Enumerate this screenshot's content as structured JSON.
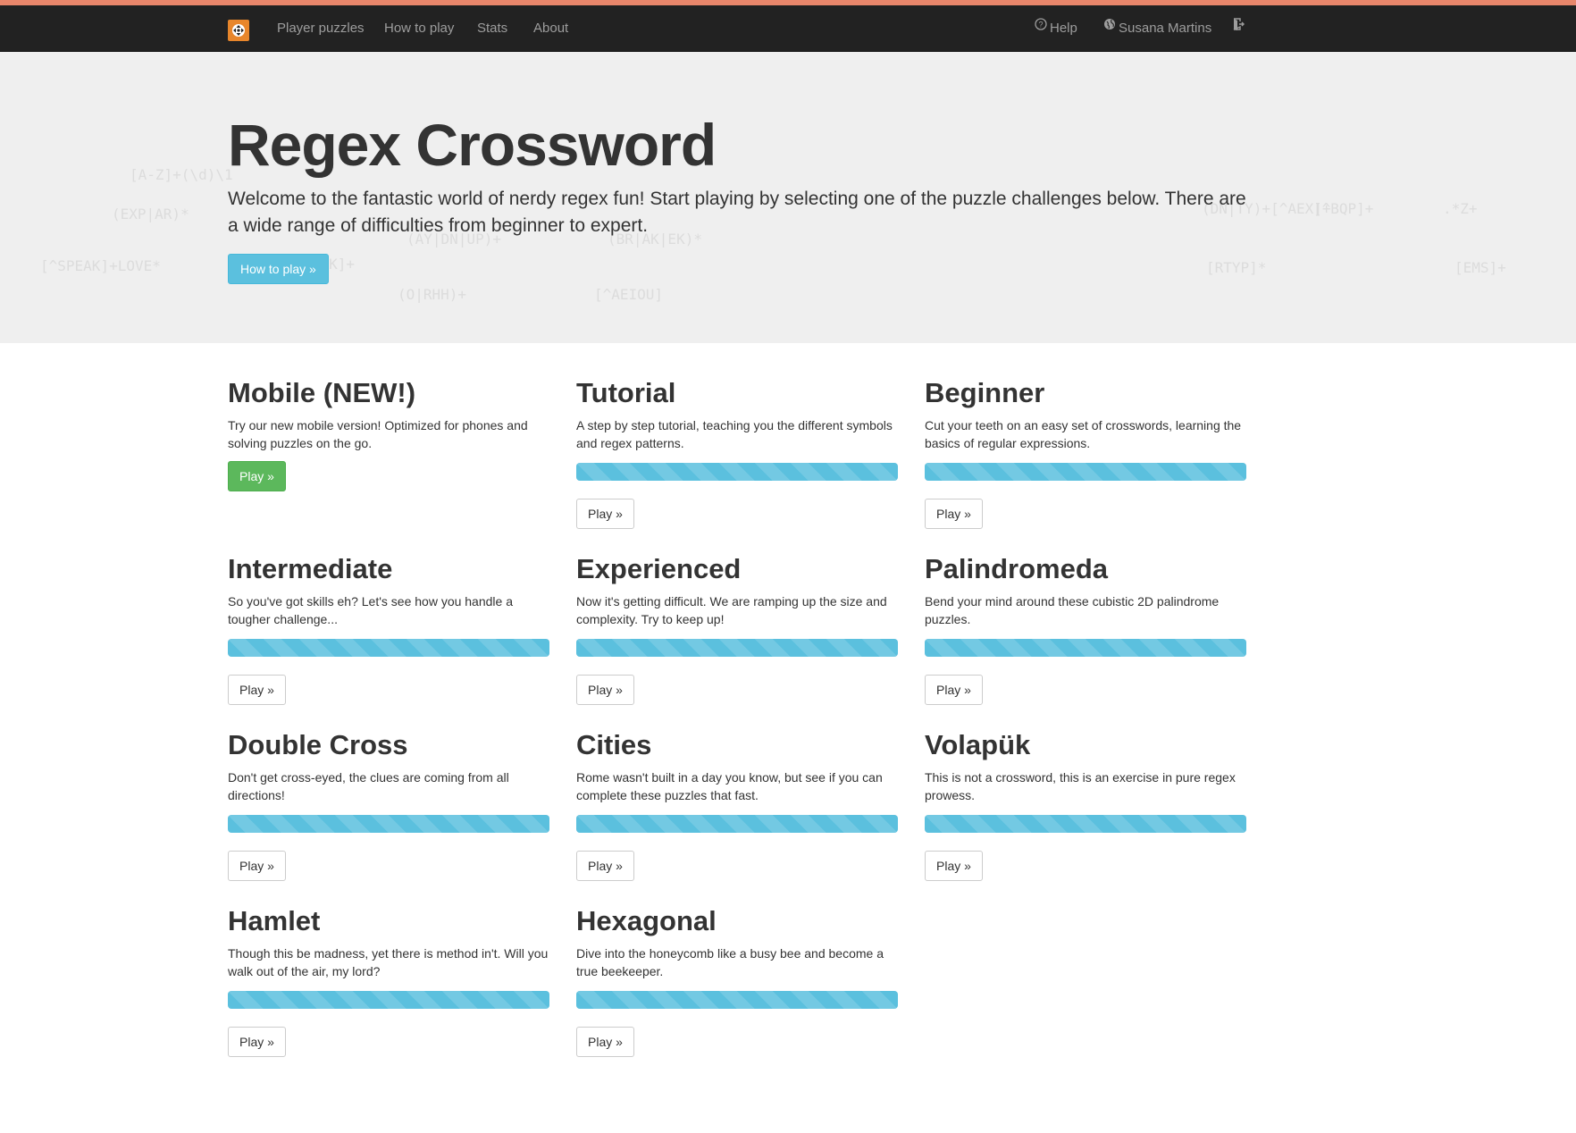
{
  "navbar": {
    "links": [
      "Player puzzles",
      "How to play",
      "Stats",
      "About"
    ],
    "help": "Help",
    "user": "Susana Martins"
  },
  "hero": {
    "title": "Regex Crossword",
    "lead": "Welcome to the fantastic world of nerdy regex fun! Start playing by selecting one of the puzzle challenges below. There are a wide range of difficulties from beginner to expert.",
    "button": "How to play »"
  },
  "puzzles": [
    {
      "title": "Mobile (NEW!)",
      "description": "Try our new mobile version! Optimized for phones and solving puzzles on the go.",
      "button": "Play »"
    },
    {
      "title": "Tutorial",
      "description": "A step by step tutorial, teaching you the different symbols and regex patterns.",
      "progress": 1.0,
      "button": "Play »"
    },
    {
      "title": "Beginner",
      "description": "Cut your teeth on an easy set of crosswords, learning the basics of regular expressions.",
      "progress": 1.0,
      "button": "Play »"
    },
    {
      "title": "Intermediate",
      "description": "So you've got skills eh? Let's see how you handle a tougher challenge...",
      "progress": 1.0,
      "button": "Play »"
    },
    {
      "title": "Experienced",
      "description": "Now it's getting difficult. We are ramping up the size and complexity. Try to keep up!",
      "progress": 1.0,
      "button": "Play »"
    },
    {
      "title": "Palindromeda",
      "description": "Bend your mind around these cubistic 2D palindrome puzzles.",
      "progress": 1.0,
      "button": "Play »"
    },
    {
      "title": "Double Cross",
      "description": "Don't get cross-eyed, the clues are coming from all directions!",
      "progress": 1.0,
      "button": "Play »"
    },
    {
      "title": "Cities",
      "description": "Rome wasn't built in a day you know, but see if you can complete these puzzles that fast.",
      "progress": 1.0,
      "button": "Play »"
    },
    {
      "title": "Volapük",
      "description": "This is not a crossword, this is an exercise in pure regex prowess.",
      "progress": 1.0,
      "button": "Play »"
    },
    {
      "title": "Hamlet",
      "description": "Though this be madness, yet there is method in't. Will you walk out of the air, my lord?",
      "progress": 1.0,
      "button": "Play »"
    },
    {
      "title": "Hexagonal",
      "description": "Dive into the honeycomb like a busy bee and become a true beekeeper.",
      "progress": 1.0,
      "button": "Play »"
    }
  ],
  "colors": {
    "navbar": "#222222",
    "accent_line": "#e8866b",
    "logo": "#e8862b",
    "info": "#5bc0de",
    "success": "#5cb85c"
  }
}
